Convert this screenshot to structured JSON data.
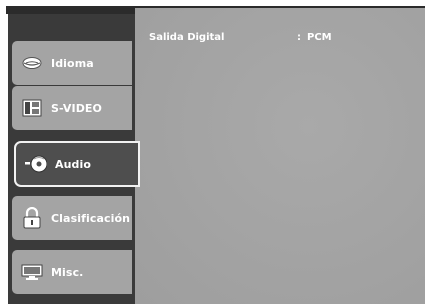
{
  "menu": {
    "tabs": [
      {
        "label": "Idioma",
        "icon": "lips-icon",
        "selected": false
      },
      {
        "label": "S-VIDEO",
        "icon": "video-output-icon",
        "selected": false
      },
      {
        "label": "Audio",
        "icon": "audio-disc-icon",
        "selected": true
      },
      {
        "label": "Clasificación",
        "icon": "lock-icon",
        "selected": false
      },
      {
        "label": "Misc.",
        "icon": "display-icon",
        "selected": false
      }
    ]
  },
  "content": {
    "setting": {
      "name": "Salida Digital",
      "separator": ":",
      "value": "PCM"
    }
  },
  "colors": {
    "selected_tab_bg": "#4e4e4e",
    "tab_bg": "#a4a4a4",
    "panel_bg": "#a2a2a2",
    "text": "#ffffff"
  }
}
